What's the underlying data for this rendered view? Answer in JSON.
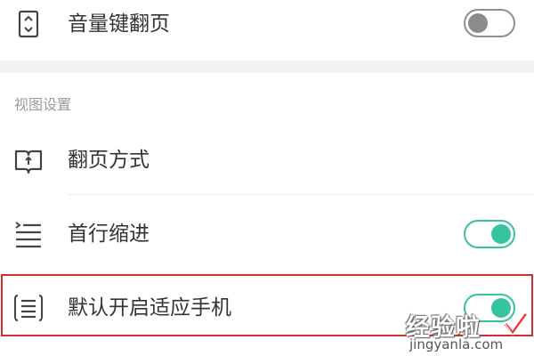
{
  "settings": {
    "volume_key_page": {
      "label": "音量键翻页",
      "icon": "volume-key-icon",
      "toggle": false
    },
    "section_view": {
      "title": "视图设置"
    },
    "page_turn_mode": {
      "label": "翻页方式",
      "icon": "book-icon"
    },
    "first_line_indent": {
      "label": "首行缩进",
      "icon": "indent-icon",
      "toggle": true
    },
    "fit_phone": {
      "label": "默认开启适应手机",
      "icon": "document-lines-icon",
      "toggle": true
    }
  },
  "colors": {
    "toggle_on": "#35c3a0",
    "toggle_off": "#8c8c8c",
    "highlight_border": "#d0312d"
  },
  "watermark": {
    "text": "经验啦",
    "url": "jingyanla.com"
  }
}
